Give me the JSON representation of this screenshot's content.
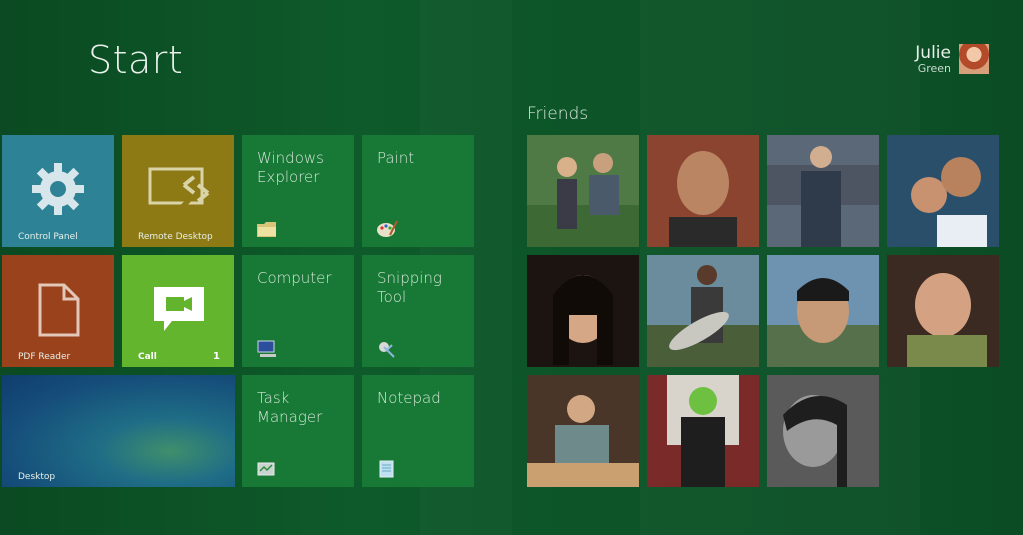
{
  "screen": {
    "title": "Start"
  },
  "user": {
    "name": "Julie",
    "subtitle": "Green"
  },
  "tiles": {
    "control_panel": "Control Panel",
    "remote_desktop": "Remote Desktop",
    "pdf_reader": "PDF Reader",
    "call": "Call",
    "call_count": "1",
    "desktop": "Desktop",
    "windows_explorer": "Windows\nExplorer",
    "paint": "Paint",
    "computer": "Computer",
    "snipping_tool": "Snipping\nTool",
    "task_manager": "Task\nManager",
    "notepad": "Notepad"
  },
  "friends": {
    "heading": "Friends",
    "count": 11
  },
  "colors": {
    "background": "#0d5428",
    "control_panel": "#2e8296",
    "remote_desktop": "#8e7a14",
    "pdf_reader": "#9a421c",
    "call": "#64b52e",
    "app_tile": "#177935"
  }
}
